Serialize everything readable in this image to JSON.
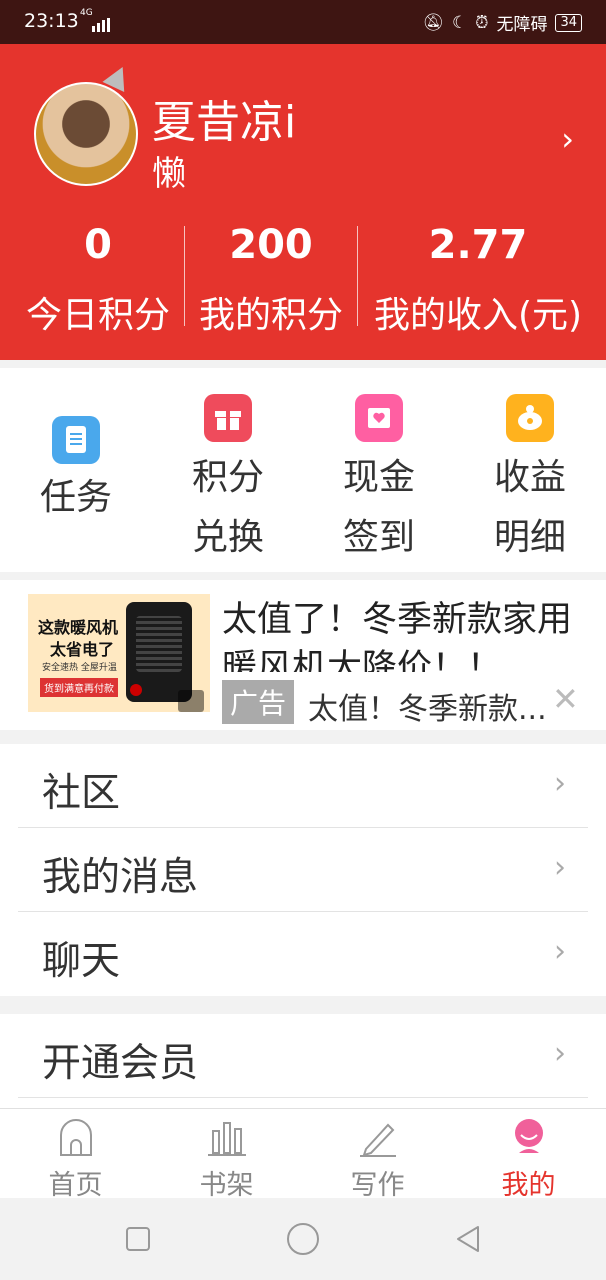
{
  "status_bar": {
    "time": "23:13",
    "network": "4G",
    "accessibility": "无障碍",
    "battery": "34"
  },
  "profile": {
    "name": "夏昔凉i",
    "tag": "懒"
  },
  "stats": [
    {
      "value": "0",
      "label": "今日积分"
    },
    {
      "value": "200",
      "label": "我的积分"
    },
    {
      "value": "2.77",
      "label": "我的收入(元)"
    }
  ],
  "grid": [
    {
      "label1": "任务",
      "label2": "",
      "icon": "task-icon",
      "color": "#4aa8ec"
    },
    {
      "label1": "积分",
      "label2": "兑换",
      "icon": "gift-icon",
      "color": "#ef4b5c"
    },
    {
      "label1": "现金",
      "label2": "签到",
      "icon": "heart-envelope-icon",
      "color": "#ff5fa2"
    },
    {
      "label1": "收益",
      "label2": "明细",
      "icon": "piggy-bank-icon",
      "color": "#ffb21e"
    }
  ],
  "ad": {
    "image_text1": "这款暖风机",
    "image_text2": "太省电了",
    "image_text3": "安全速热 全屋升温",
    "image_text4": "货到满意再付款",
    "title": "太值了！冬季新款家用暖风机大降价！！",
    "badge": "广告",
    "subtitle": "太值！冬季新款..."
  },
  "menu1": [
    {
      "label": "社区"
    },
    {
      "label": "我的消息"
    },
    {
      "label": "聊天"
    }
  ],
  "menu2": [
    {
      "label": "开通会员"
    }
  ],
  "tabs": [
    {
      "label": "首页",
      "icon": "home-icon"
    },
    {
      "label": "书架",
      "icon": "bookshelf-icon"
    },
    {
      "label": "写作",
      "icon": "pencil-icon"
    },
    {
      "label": "我的",
      "icon": "profile-icon"
    }
  ],
  "colors": {
    "brand": "#e5342d",
    "active_tab": "#e5342d"
  }
}
